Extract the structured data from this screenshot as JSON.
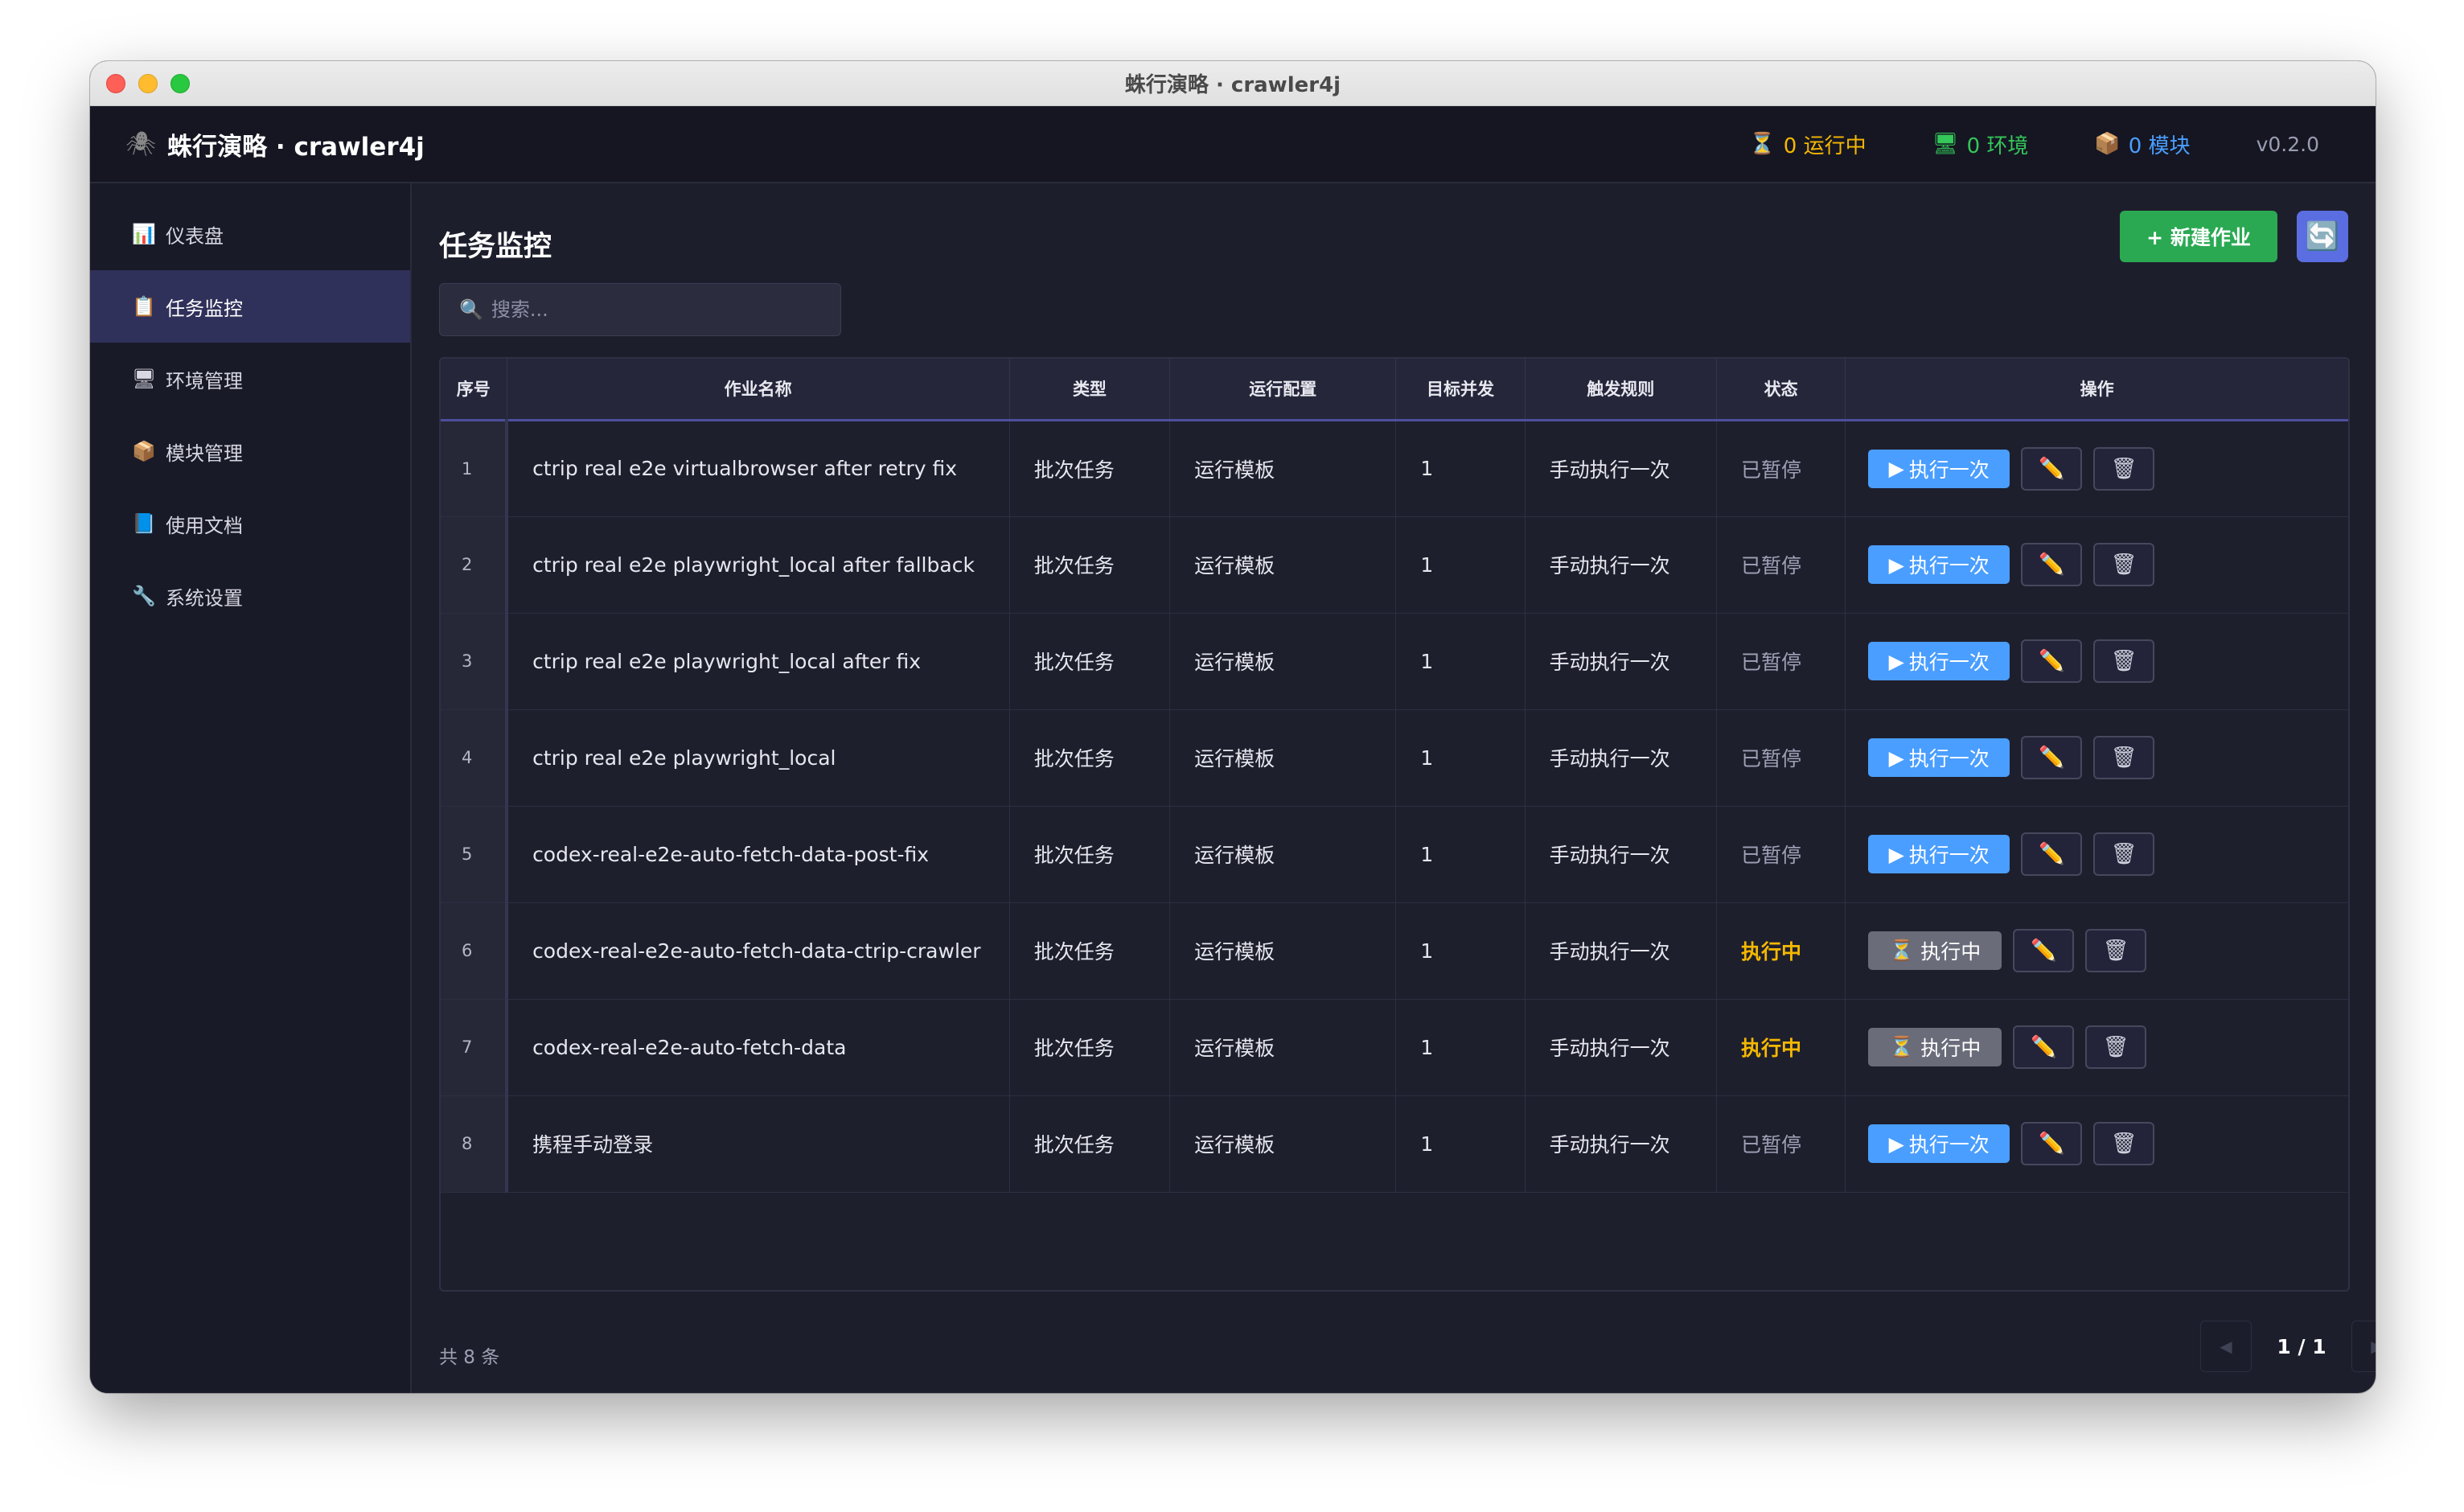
{
  "window": {
    "title": "蛛行演略 · crawler4j"
  },
  "header": {
    "brand": "蛛行演略 · crawler4j",
    "logo_icon": "spider-icon",
    "stats": {
      "running": "0 运行中",
      "env": "0 环境",
      "modules": "0 模块"
    },
    "version": "v0.2.0"
  },
  "sidebar": {
    "items": [
      {
        "label": "仪表盘",
        "icon": "chart-icon",
        "glyph": "📊"
      },
      {
        "label": "任务监控",
        "icon": "clipboard-icon",
        "glyph": "📋"
      },
      {
        "label": "环境管理",
        "icon": "monitor-icon",
        "glyph": "🖥"
      },
      {
        "label": "模块管理",
        "icon": "package-icon",
        "glyph": "📦"
      },
      {
        "label": "使用文档",
        "icon": "book-icon",
        "glyph": "📘"
      },
      {
        "label": "系统设置",
        "icon": "wrench-icon",
        "glyph": "🔧"
      }
    ],
    "active_index": 1
  },
  "main": {
    "title": "任务监控",
    "new_button": "+ 新建作业",
    "search": {
      "placeholder": "搜索..."
    },
    "table": {
      "headers": [
        "序号",
        "作业名称",
        "类型",
        "运行配置",
        "目标并发",
        "触发规则",
        "状态",
        "操作"
      ],
      "rows": [
        {
          "idx": "1",
          "name": "ctrip real e2e virtualbrowser after retry fix",
          "type": "批次任务",
          "config": "运行模板",
          "concurrency": "1",
          "trigger": "手动执行一次",
          "status": "已暂停",
          "running": false
        },
        {
          "idx": "2",
          "name": "ctrip real e2e playwright_local after fallback",
          "type": "批次任务",
          "config": "运行模板",
          "concurrency": "1",
          "trigger": "手动执行一次",
          "status": "已暂停",
          "running": false
        },
        {
          "idx": "3",
          "name": "ctrip real e2e playwright_local after fix",
          "type": "批次任务",
          "config": "运行模板",
          "concurrency": "1",
          "trigger": "手动执行一次",
          "status": "已暂停",
          "running": false
        },
        {
          "idx": "4",
          "name": "ctrip real e2e playwright_local",
          "type": "批次任务",
          "config": "运行模板",
          "concurrency": "1",
          "trigger": "手动执行一次",
          "status": "已暂停",
          "running": false
        },
        {
          "idx": "5",
          "name": "codex-real-e2e-auto-fetch-data-post-fix",
          "type": "批次任务",
          "config": "运行模板",
          "concurrency": "1",
          "trigger": "手动执行一次",
          "status": "已暂停",
          "running": false
        },
        {
          "idx": "6",
          "name": "codex-real-e2e-auto-fetch-data-ctrip-crawler",
          "type": "批次任务",
          "config": "运行模板",
          "concurrency": "1",
          "trigger": "手动执行一次",
          "status": "执行中",
          "running": true
        },
        {
          "idx": "7",
          "name": "codex-real-e2e-auto-fetch-data",
          "type": "批次任务",
          "config": "运行模板",
          "concurrency": "1",
          "trigger": "手动执行一次",
          "status": "执行中",
          "running": true
        },
        {
          "idx": "8",
          "name": "携程手动登录",
          "type": "批次任务",
          "config": "运行模板",
          "concurrency": "1",
          "trigger": "手动执行一次",
          "status": "已暂停",
          "running": false
        }
      ],
      "run_label": "执行一次",
      "running_label": "执行中"
    },
    "total": "共 8 条",
    "pager": {
      "label": "1 / 1"
    }
  },
  "colors": {
    "accent": "#4a9eff",
    "success": "#2aa952",
    "warning": "#f5b800",
    "active_nav": "#30315a"
  }
}
